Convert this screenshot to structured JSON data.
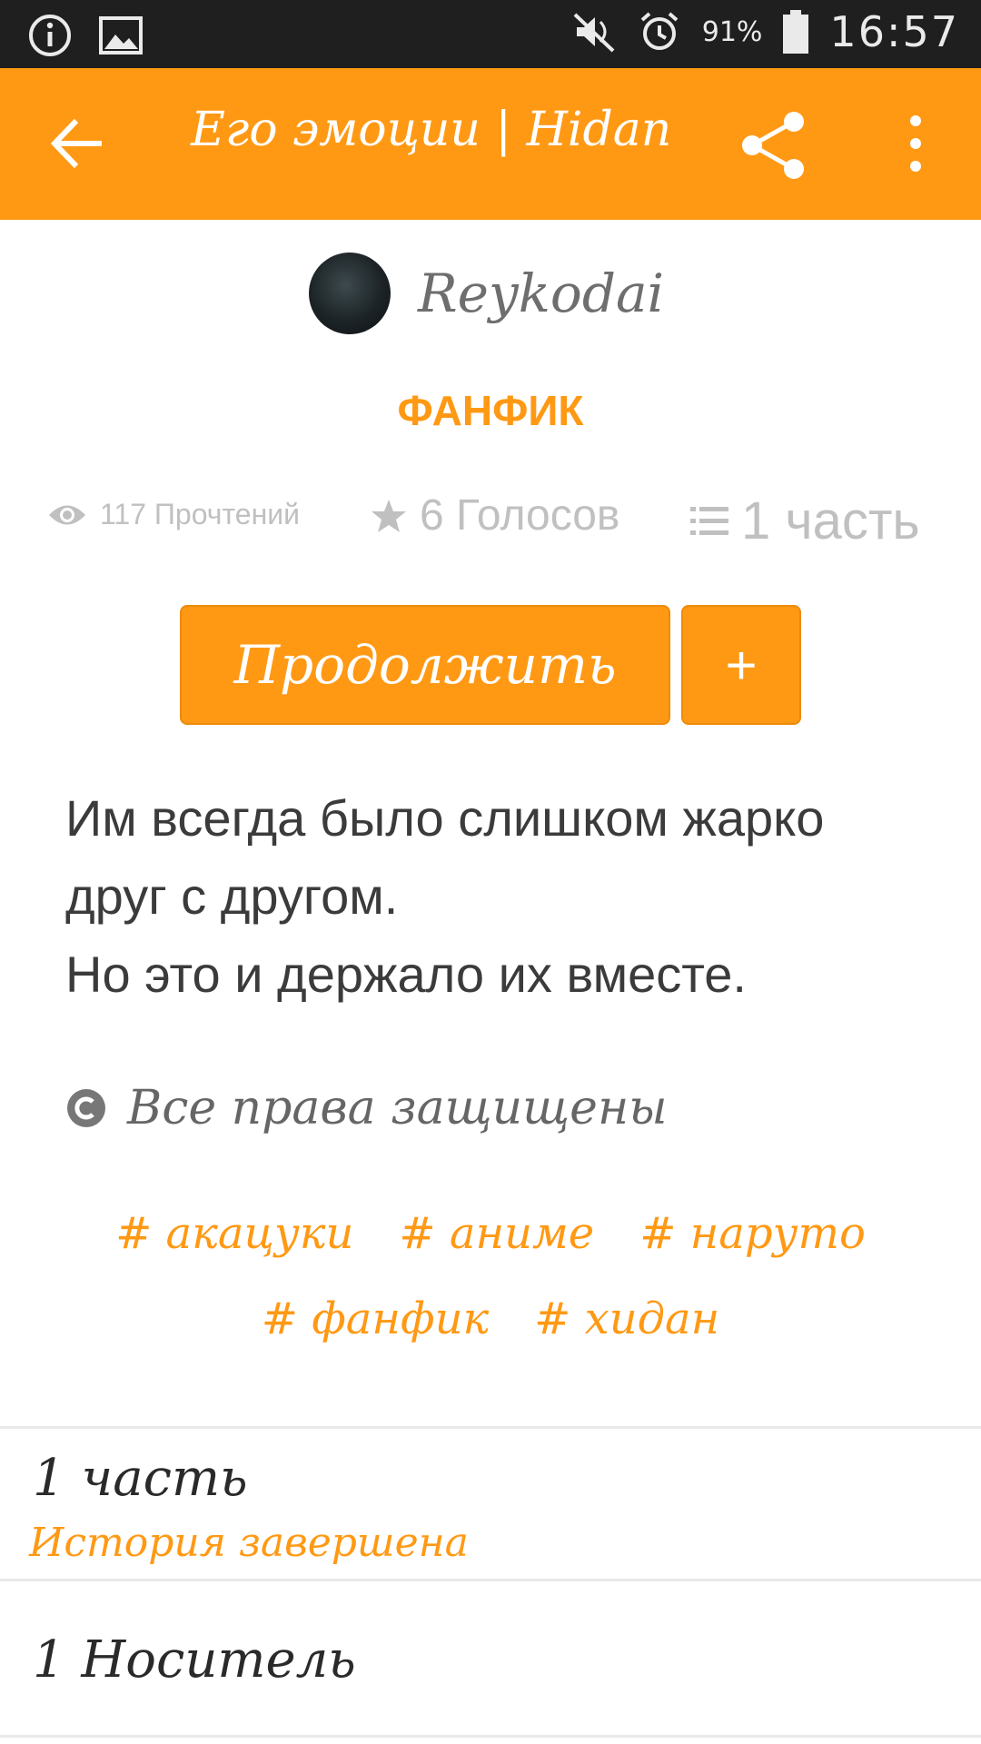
{
  "status_bar": {
    "battery_percent": "91%",
    "time": "16:57",
    "icons": [
      "info-icon",
      "image-icon",
      "mute-icon",
      "alarm-icon",
      "battery-icon"
    ]
  },
  "app_bar": {
    "title": "Его эмоции | Hidan",
    "icons": [
      "back-arrow-icon",
      "share-icon",
      "more-vert-icon"
    ]
  },
  "author": {
    "name": "Reykodai"
  },
  "category": "ФАНФИК",
  "stats": {
    "reads": "117 Прочтений",
    "votes": "6 Голосов",
    "parts": "1 часть"
  },
  "actions": {
    "continue_label": "Продолжить",
    "add_label": "+"
  },
  "description": {
    "line1": "Им всегда было слишком жарко друг с другом.",
    "line2": "Но это и держало их вместе."
  },
  "copyright": "Все права защищены",
  "tags": [
    "# акацуки",
    "# аниме",
    "# наруто",
    "# фанфик",
    "# хидан"
  ],
  "rows": [
    {
      "title": "1 часть",
      "subtitle": "История завершена"
    },
    {
      "title": "1 Носитель"
    }
  ],
  "colors": {
    "accent": "#ff9914",
    "status_bar": "#1f1f1f",
    "muted": "#c0c0c0"
  }
}
